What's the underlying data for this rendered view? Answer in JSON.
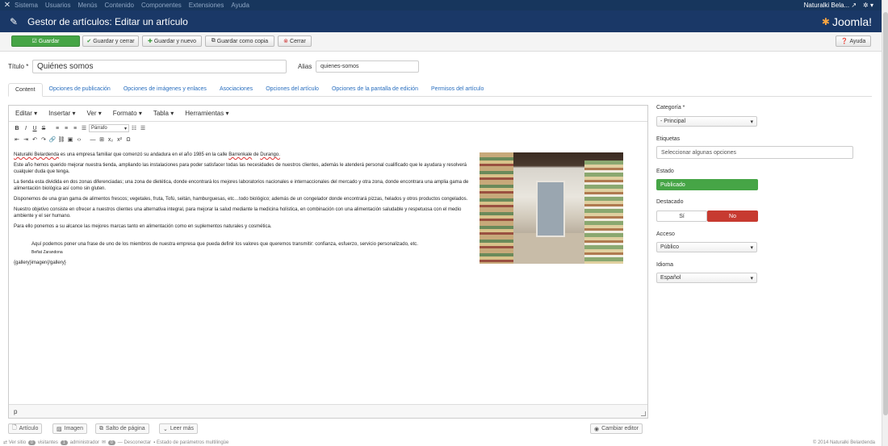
{
  "topnav": {
    "menu": [
      "Sistema",
      "Usuarios",
      "Menús",
      "Contenido",
      "Componentes",
      "Extensiones",
      "Ayuda"
    ],
    "user": "Naturalki Bela...",
    "user_icon": "external-link-icon",
    "settings_icon": "gear-icon"
  },
  "header": {
    "title": "Gestor de artículos: Editar un artículo",
    "logo_text": "Joomla!"
  },
  "toolbar": {
    "save": "Guardar",
    "save_close": "Guardar y cerrar",
    "save_new": "Guardar y nuevo",
    "save_copy": "Guardar como copia",
    "close": "Cerrar",
    "help": "Ayuda"
  },
  "form": {
    "title_label": "Título *",
    "title_value": "Quiénes somos",
    "alias_label": "Alias",
    "alias_value": "quienes-somos"
  },
  "tabs": [
    "Content",
    "Opciones de publicación",
    "Opciones de imágenes y enlaces",
    "Asociaciones",
    "Opciones del artículo",
    "Opciones de la pantalla de edición",
    "Permisos del artículo"
  ],
  "editor": {
    "menus": [
      "Editar",
      "Insertar",
      "Ver",
      "Formato",
      "Tabla",
      "Herramientas"
    ],
    "format_select": "Párrafo",
    "paragraphs": {
      "p1_a": "Naturalki Belardenda",
      "p1_b": " es una empresa familiar que comenzó su andadura  en el año 1985 en la calle ",
      "p1_c": "Barrenkale",
      "p1_d": " de ",
      "p1_e": "Durango.",
      "p2": "Este año hemos querido mejorar nuestra tienda, ampliando las instalaciones para poder satisfacer todas las necesidades de nuestros clientes, además le atenderá personal cualificado que le ayudara y resolverá cualquier duda que tenga.",
      "p3": "La tienda esta dividida en dos zonas diferenciadas; una zona de dietética, donde encontrará los mejores laboratorios nacionales e internaccionales del mercado y otra  zona, donde encontrara una amplia gama de alimentación biológica así  como sin gluten.",
      "p4": "Disponemos de una gran gama de alimentos frescos; vegetales, fruta, Tofú, seitán, hamburguesas, etc…todo biológico; además de un congelador donde encontrará pizzas, helados y otros productos congelados.",
      "p5": "Nuestro objetivo consiste en ofrecer a nuestros clientes una alternativa integral, para mejorar la salud mediante la medicina holística, en combinación con una alimentación saludable y respetuosa con el medio ambiente y el ser humano.",
      "p6": "Para ello ponemos a su alcance las mejores marcas tanto en alimentación como en suplementos naturales y cosmética.",
      "quote": "Aquí podemos poner una frase de uno de los miembros de nuestra empresa que pueda definir los valores que queremos transmitir: confianza, esfuerzo, servicio personalizado, etc.",
      "quote_author": "Beñat Zarandona",
      "gallery": "{gallery}imagen{/gallery}"
    },
    "path": "p"
  },
  "editor_buttons": {
    "article": "Artículo",
    "image": "Imagen",
    "pagebreak": "Salto de página",
    "readmore": "Leer más",
    "toggle": "Cambiar editor"
  },
  "sidebar": {
    "category_label": "Categoría *",
    "category_value": "- Principal",
    "tags_label": "Etiquetas",
    "tags_placeholder": "Seleccionar algunas opciones",
    "status_label": "Estado",
    "status_value": "Publicado",
    "featured_label": "Destacado",
    "featured_yes": "Sí",
    "featured_no": "No",
    "access_label": "Acceso",
    "access_value": "Público",
    "language_label": "Idioma",
    "language_value": "Español"
  },
  "footer": {
    "view_site": "Ver sitio",
    "visitors_count": "0",
    "visitors": "visitantes",
    "admins_count": "1",
    "admins": "administrador",
    "messages_count": "0",
    "logout": "Desconectar",
    "multilang": "Estado de parámetros multilingüe",
    "copyright": "© 2014 Naturalki Belardenda"
  },
  "colors": {
    "topbar": "#17365d",
    "header": "#1a3867",
    "save_green": "#46a546",
    "published_green": "#46a546",
    "no_red": "#c73a30",
    "link_blue": "#2a6fbf"
  }
}
